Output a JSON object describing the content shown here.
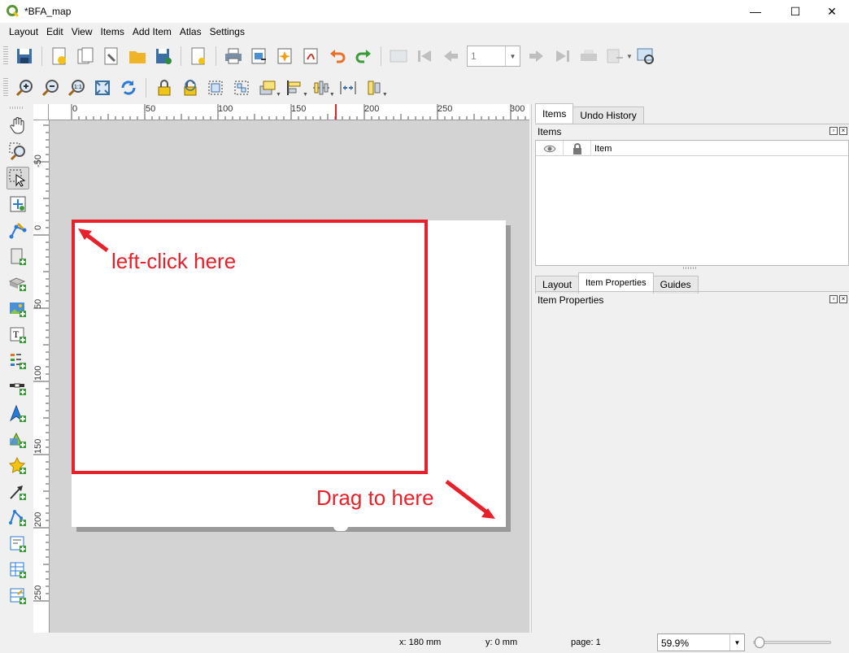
{
  "window": {
    "title": "*BFA_map",
    "minimize": "—",
    "maximize": "☐",
    "close": "✕"
  },
  "menu": [
    "Layout",
    "Edit",
    "View",
    "Items",
    "Add Item",
    "Atlas",
    "Settings"
  ],
  "atlas_page_value": "1",
  "rulers": {
    "h_labels": [
      "0",
      "50",
      "100",
      "150",
      "200",
      "250",
      "300"
    ],
    "v_labels": [
      "-50",
      "0",
      "50",
      "100",
      "150",
      "200",
      "250"
    ]
  },
  "annotations": {
    "click": "left-click here",
    "drag": "Drag to here"
  },
  "dock": {
    "top_tabs": [
      "Items",
      "Undo History"
    ],
    "items_title": "Items",
    "items_columns": {
      "item": "Item"
    },
    "bottom_tabs": [
      "Layout",
      "Item Properties",
      "Guides"
    ],
    "properties_title": "Item Properties"
  },
  "status": {
    "x": "x: 180 mm",
    "y": "y: 0 mm",
    "page": "page: 1",
    "zoom": "59.9%"
  },
  "colors": {
    "annotation": "#e8202a"
  }
}
